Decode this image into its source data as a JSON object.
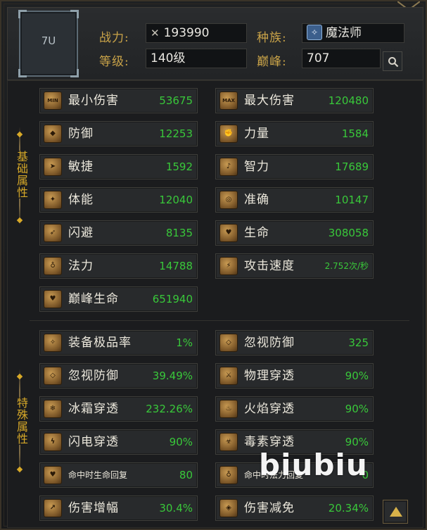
{
  "header": {
    "portrait_label": "7U",
    "power_label": "战力:",
    "power_value": "193990",
    "race_label": "种族:",
    "race_value": "魔法师",
    "level_label": "等级:",
    "level_value": "140级",
    "peak_label": "巅峰:",
    "peak_value": "707",
    "search_icon": "search-icon"
  },
  "sections": {
    "basic_label": "基础属性",
    "special_label": "特殊属性"
  },
  "basic_stats": [
    {
      "label": "最小伤害",
      "value": "53675",
      "icon": "min-damage-icon",
      "glyph": "MIN"
    },
    {
      "label": "最大伤害",
      "value": "120480",
      "icon": "max-damage-icon",
      "glyph": "MAX"
    },
    {
      "label": "防御",
      "value": "12253",
      "icon": "shield-icon",
      "glyph": "◆"
    },
    {
      "label": "力量",
      "value": "1584",
      "icon": "fist-icon",
      "glyph": "✊"
    },
    {
      "label": "敏捷",
      "value": "1592",
      "icon": "boot-icon",
      "glyph": "➤"
    },
    {
      "label": "智力",
      "value": "17689",
      "icon": "staff-icon",
      "glyph": "♪"
    },
    {
      "label": "体能",
      "value": "12040",
      "icon": "muscle-icon",
      "glyph": "✦"
    },
    {
      "label": "准确",
      "value": "10147",
      "icon": "target-icon",
      "glyph": "◎"
    },
    {
      "label": "闪避",
      "value": "8135",
      "icon": "dodge-icon",
      "glyph": "➶"
    },
    {
      "label": "生命",
      "value": "308058",
      "icon": "heart-icon",
      "glyph": "♥"
    },
    {
      "label": "法力",
      "value": "14788",
      "icon": "potion-icon",
      "glyph": "♁"
    },
    {
      "label": "攻击速度",
      "value": "2.752次/秒",
      "icon": "attack-speed-icon",
      "glyph": "⚡"
    },
    {
      "label": "巅峰生命",
      "value": "651940",
      "icon": "peak-heart-icon",
      "glyph": "♥"
    }
  ],
  "special_stats": [
    {
      "label": "装备极品率",
      "value": "1%",
      "icon": "gear-quality-icon",
      "glyph": "✧"
    },
    {
      "label": "忽视防御",
      "value": "325",
      "icon": "ignore-defense-icon",
      "glyph": "◇"
    },
    {
      "label": "忽视防御",
      "value": "39.49%",
      "icon": "ignore-defense-percent-icon",
      "glyph": "◇"
    },
    {
      "label": "物理穿透",
      "value": "90%",
      "icon": "physical-pierce-icon",
      "glyph": "⚔"
    },
    {
      "label": "冰霜穿透",
      "value": "232.26%",
      "icon": "frost-pierce-icon",
      "glyph": "❄"
    },
    {
      "label": "火焰穿透",
      "value": "90%",
      "icon": "fire-pierce-icon",
      "glyph": "♨"
    },
    {
      "label": "闪电穿透",
      "value": "90%",
      "icon": "lightning-pierce-icon",
      "glyph": "ϟ"
    },
    {
      "label": "毒素穿透",
      "value": "90%",
      "icon": "poison-pierce-icon",
      "glyph": "☣"
    },
    {
      "label": "命中时生命回复",
      "value": "80",
      "icon": "lifesteal-icon",
      "glyph": "♥"
    },
    {
      "label": "命中时法力回复",
      "value": "0",
      "icon": "manasteal-icon",
      "glyph": "♁"
    },
    {
      "label": "伤害增幅",
      "value": "30.4%",
      "icon": "damage-boost-icon",
      "glyph": "↗"
    },
    {
      "label": "伤害减免",
      "value": "20.34%",
      "icon": "damage-reduce-icon",
      "glyph": "◈"
    }
  ],
  "watermark": "biubiu",
  "colors": {
    "gold": "#c9a348",
    "value_green": "#39c83a",
    "label": "#ece8dc"
  }
}
